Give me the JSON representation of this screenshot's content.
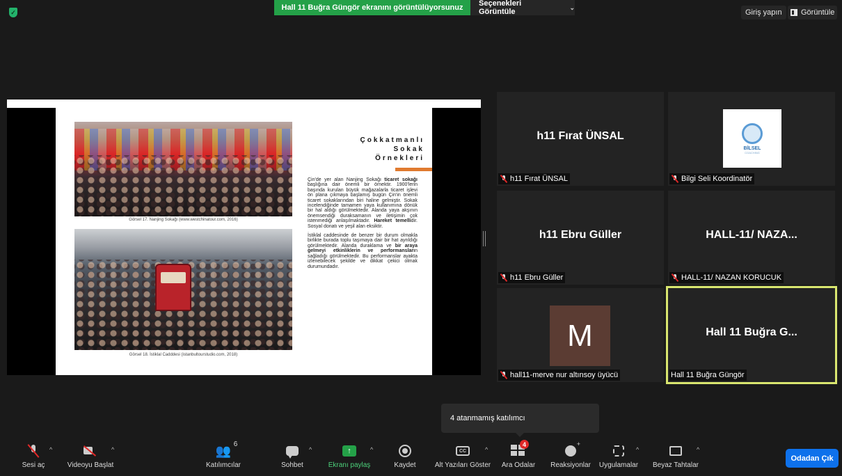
{
  "topbar": {
    "share_banner": "Hall 11 Buğra Güngör ekranını görüntülüyorsunuz",
    "view_options": "Seçenekleri Görüntüle",
    "sign_in": "Giriş yapın",
    "view": "Görüntüle"
  },
  "slide": {
    "title_line1": "Çokkatmanlı",
    "title_line2": "Sokak",
    "title_line3": "Örnekleri",
    "caption1": "Görsel 17. Nanjing Sokağı (www.westchinatour.com, 2016)",
    "caption2": "Görsel 18. İstiklal Cadddesi (istanbultourstudio.com, 2018)",
    "p1_a": "Çin'de yer alan Nanjing Sokağı ",
    "p1_b": "ticaret sokağı",
    "p1_c": " başlığına dair önemli bir örnektir. 1900'lerin başında kurulan büyük mağazalarla ticaret işlevi ön plana çıkmaya başlamış bugün Çin'in önemli ticaret sokaklarından biri haline gelmiştir. Sokak incelendiğinde tamamen yaya kullanımına dönük bir hal aldığı görülmektedir. Alanda yaya akşının önemsendiği duraksamanın ve iletişimin çok istenmediği anlaşılmaktadır. ",
    "p1_d": "Hareket temelli",
    "p1_e": "dir. Sosyal donatı ve yeşil alan eksiktir.",
    "p2_a": "İstiklal caddesinde de benzer bir durum olmakla birlikte burada toplu taşımaya dair bir hat ayrıldığı görülmektedir. Alanda duraklama ve ",
    "p2_b": "bir araya gelmeyi etkinliklerin ve performansları",
    "p2_c": "n sağladığı görülmektedir. Bu performanslar ayakta izlenebilecek şekilde ve dikkat çekici olmak durumundadır."
  },
  "tiles": [
    {
      "center": "h11 Fırat ÜNSAL",
      "label": "h11 Fırat ÜNSAL"
    },
    {
      "center": "",
      "label": "Bilgi Seli Koordinatör",
      "logo_text": "BİLSEL",
      "logo_sub": "COACHING"
    },
    {
      "center": "h11 Ebru Güller",
      "label": "h11 Ebru Güller"
    },
    {
      "center": "HALL-11/  NAZA...",
      "label": "HALL-11/ NAZAN KORUCUK"
    },
    {
      "center": "M",
      "label": "hall11-merve nur altınsoy üyücü"
    },
    {
      "center": "Hall 11 Buğra G...",
      "label": "Hall 11 Buğra Güngör"
    }
  ],
  "tooltip": "4 atanmamış katılımcı",
  "toolbar": {
    "unmute": "Sesi aç",
    "start_video": "Videoyu Başlat",
    "participants": "Katılımcılar",
    "participants_count": "6",
    "chat": "Sohbet",
    "share": "Ekranı paylaş",
    "record": "Kaydet",
    "captions": "Alt Yazıları Göster",
    "cc_icon": "CC",
    "breakout": "Ara Odalar",
    "breakout_badge": "4",
    "reactions": "Reaksiyonlar",
    "apps": "Uygulamalar",
    "whiteboard": "Beyaz Tahtalar",
    "leave": "Odadan Çık"
  },
  "colors": {
    "share_green": "#24a148",
    "leave_blue": "#0e71eb",
    "active_speaker": "#d9e66f",
    "mute_red": "#e02828"
  }
}
